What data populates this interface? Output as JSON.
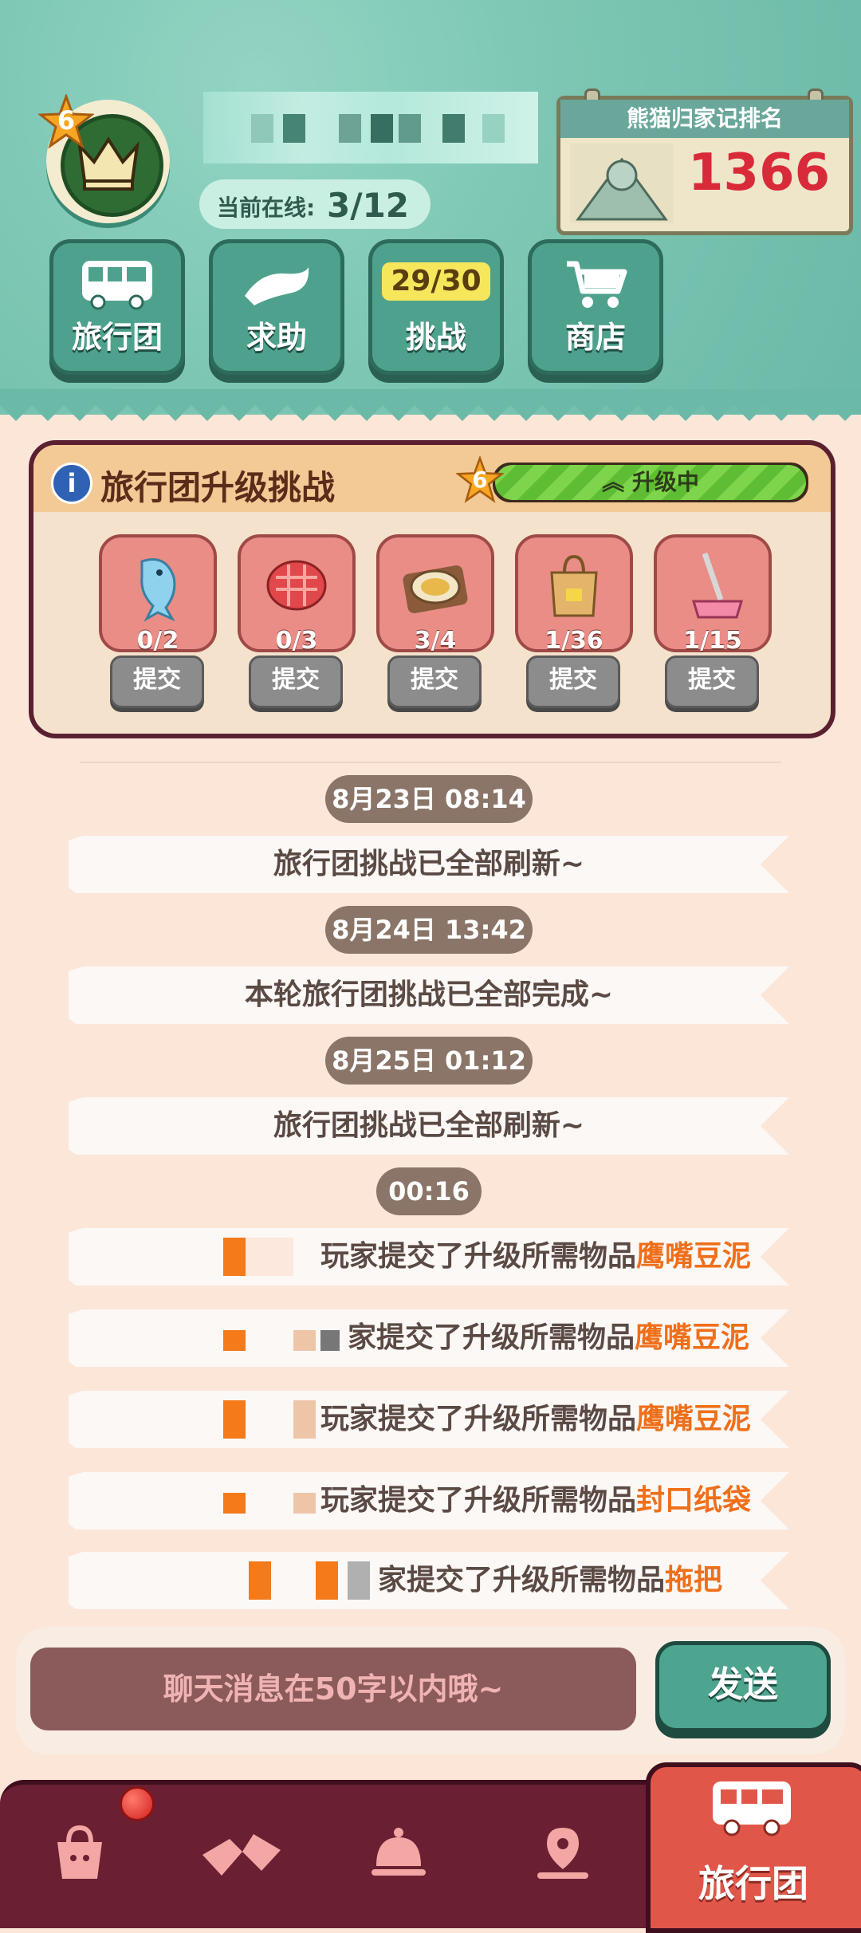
{
  "header": {
    "level": "6",
    "online_label": "当前在线:",
    "online_value": "3/12",
    "rank_title": "熊猫归家记排名",
    "rank_value": "1366",
    "nav": [
      {
        "label": "旅行团",
        "icon": "bus-icon"
      },
      {
        "label": "求助",
        "icon": "hand-icon"
      },
      {
        "label": "挑战",
        "icon": "challenge-icon",
        "count": "29/30"
      },
      {
        "label": "商店",
        "icon": "cart-icon"
      }
    ]
  },
  "panel": {
    "title": "旅行团升级挑战",
    "level": "6",
    "status": "升级中",
    "progress": 1.0,
    "items": [
      {
        "icon": "dolphin-icon",
        "count": "0/2",
        "submit": "提交"
      },
      {
        "icon": "meat-icon",
        "count": "0/3",
        "submit": "提交"
      },
      {
        "icon": "dish-icon",
        "count": "3/4",
        "submit": "提交"
      },
      {
        "icon": "paper-bag-icon",
        "count": "1/36",
        "submit": "提交"
      },
      {
        "icon": "mop-icon",
        "count": "1/15",
        "submit": "提交"
      }
    ]
  },
  "chat": {
    "entries": [
      {
        "time": "8月23日 08:14",
        "text": "旅行团挑战已全部刷新~"
      },
      {
        "time": "8月24日 13:42",
        "text": "本轮旅行团挑战已全部完成~"
      },
      {
        "time": "8月25日 01:12",
        "text": "旅行团挑战已全部刷新~"
      },
      {
        "time": "00:16"
      }
    ],
    "player_messages": [
      {
        "prefix": "玩家提交了升级所需物品",
        "item": "鹰嘴豆泥"
      },
      {
        "prefix": "家提交了升级所需物品",
        "item": "鹰嘴豆泥"
      },
      {
        "prefix": "玩家提交了升级所需物品",
        "item": "鹰嘴豆泥"
      },
      {
        "prefix": "玩家提交了升级所需物品",
        "item": "封口纸袋"
      },
      {
        "prefix": "家提交了升级所需物品",
        "item": "拖把"
      }
    ]
  },
  "composer": {
    "placeholder": "聊天消息在50字以内哦~",
    "send": "发送"
  },
  "bottom_nav": {
    "items": [
      "bag-icon",
      "hands-icon",
      "bell-icon",
      "map-icon"
    ],
    "active_label": "旅行团",
    "active_icon": "bus-icon"
  },
  "colors": {
    "header_bg": "#7cc6b3",
    "panel_border": "#5a2030",
    "highlight": "#ef6f1a",
    "bottom_nav": "#6a1f33",
    "active_tab": "#e0574a"
  }
}
